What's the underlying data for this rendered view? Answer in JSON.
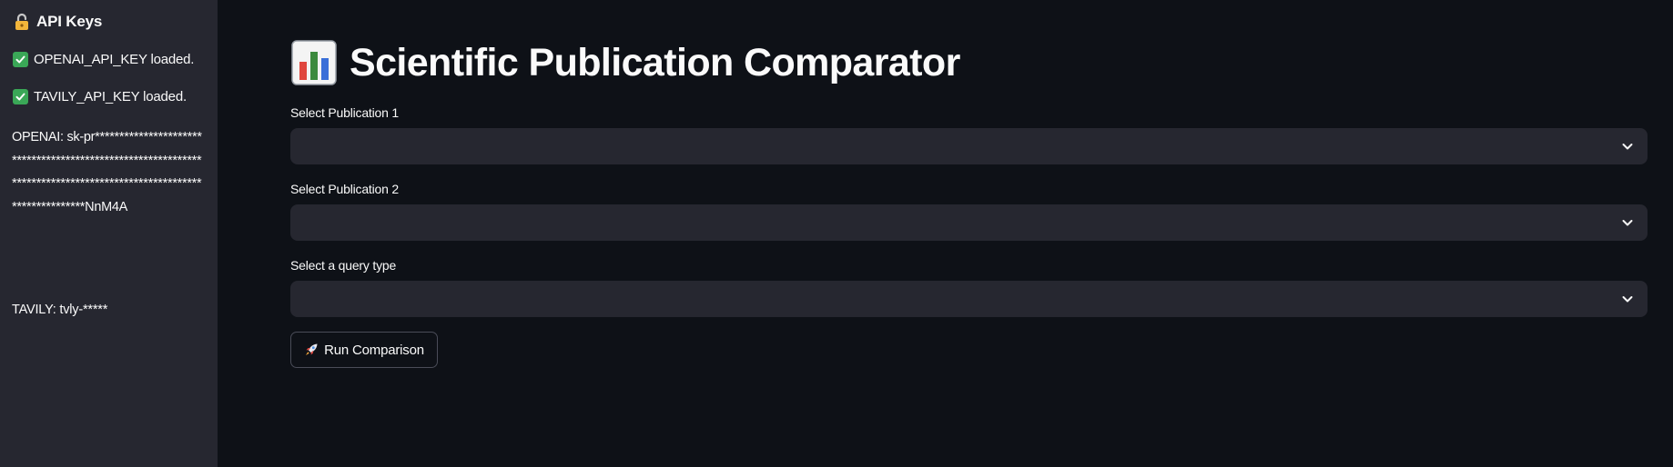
{
  "sidebar": {
    "title": "API Keys",
    "title_icon": "lock-icon",
    "status_lines": [
      {
        "icon": "check-icon",
        "text": "OPENAI_API_KEY loaded."
      },
      {
        "icon": "check-icon",
        "text": "TAVILY_API_KEY loaded."
      }
    ],
    "openai_masked": "OPENAI: sk-pr*******************************************************************************************************************NnM4A",
    "tavily_masked": "TAVILY: tvly-*****"
  },
  "main": {
    "title": "Scientific Publication Comparator",
    "title_icon": "bar-chart-icon",
    "fields": [
      {
        "label": "Select Publication 1",
        "value": ""
      },
      {
        "label": "Select Publication 2",
        "value": ""
      },
      {
        "label": "Select a query type",
        "value": ""
      }
    ],
    "run_button_label": "Run Comparison",
    "run_button_icon": "rocket-icon"
  },
  "colors": {
    "background": "#0e1117",
    "sidebar": "#262730",
    "select_bg": "#262730",
    "text": "#fafafa",
    "check_green": "#3aa757"
  }
}
